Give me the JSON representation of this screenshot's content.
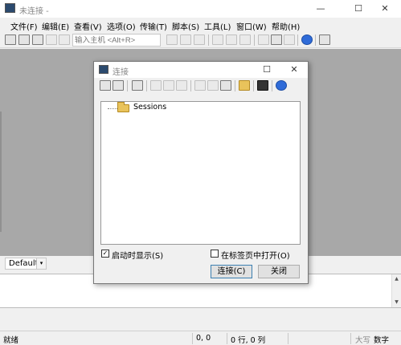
{
  "window": {
    "title": "未连接 -",
    "minimize": "—",
    "maximize": "☐",
    "close": "✕"
  },
  "menu": [
    "文件(F)",
    "编辑(E)",
    "查看(V)",
    "选项(O)",
    "传输(T)",
    "脚本(S)",
    "工具(L)",
    "窗口(W)",
    "帮助(H)"
  ],
  "toolbar": {
    "host_placeholder": "输入主机 <Alt+R>"
  },
  "tabbar": {
    "session_select": "Default",
    "arrow": "▾"
  },
  "statusbar": {
    "status": "就绪",
    "cursor_pos": "0, 0",
    "rows_cols": "0 行, 0 列",
    "caps": "大写",
    "num": "数字"
  },
  "dialog": {
    "title": "连接",
    "maximize": "☐",
    "close": "✕",
    "tree": {
      "root": "Sessions"
    },
    "startup_checkbox": {
      "label": "启动时显示(S)",
      "checked": true,
      "mark": "✓"
    },
    "tab_checkbox": {
      "label": "在标签页中打开(O)",
      "checked": false
    },
    "connect_button": "连接(C)",
    "close_button": "关闭"
  },
  "colors": {
    "workspace": "#a8a8a8",
    "folder": "#e9c35b",
    "accent": "#3c7fb1"
  }
}
